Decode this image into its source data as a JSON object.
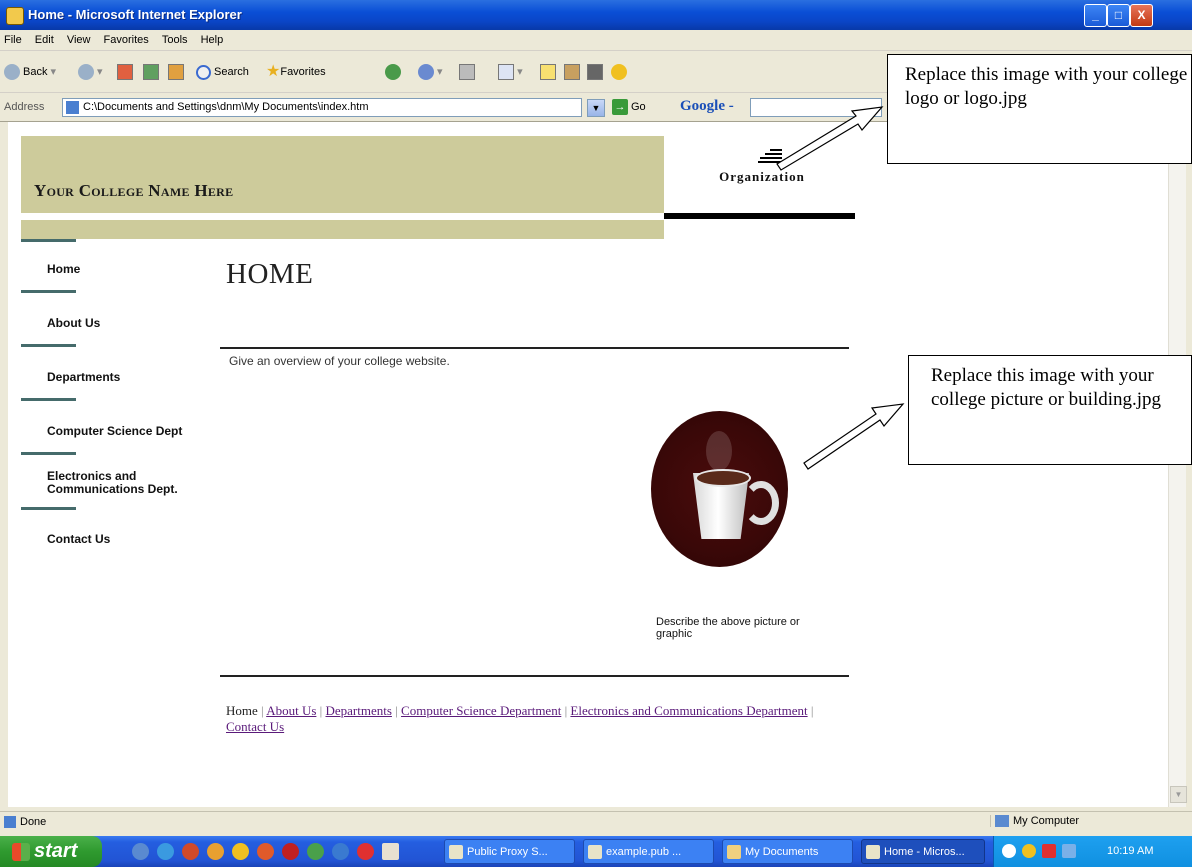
{
  "window": {
    "title": "Home - Microsoft Internet Explorer",
    "buttons": [
      "_",
      "□",
      "X"
    ]
  },
  "menubar": {
    "items": [
      "File",
      "Edit",
      "View",
      "Favorites",
      "Tools",
      "Help"
    ]
  },
  "toolbar": {
    "back_label": "Back",
    "search_label": "Search",
    "favorites_label": "Favorites"
  },
  "addressbar": {
    "label": "Address",
    "url": "C:\\Documents and Settings\\dnm\\My Documents\\index.htm",
    "go_label": "Go",
    "google_label": "Google -"
  },
  "page": {
    "college_name": "Your College Name Here",
    "logo_text": "Organization",
    "nav": [
      "Home",
      "About Us",
      "Departments",
      "Computer Science Dept",
      "Electronics and Communications Dept.",
      "Contact Us"
    ],
    "title": "HOME",
    "overview": "Give an overview of your college website.",
    "caption": "Describe the above picture or graphic",
    "footer": {
      "home": "Home",
      "links": [
        "About Us",
        "Departments",
        "Computer Science Department",
        "Electronics and Communications Department",
        "Contact Us"
      ],
      "separator": "|"
    }
  },
  "callouts": {
    "logo": "Replace this image with your college logo or logo.jpg",
    "picture": "Replace this image with your college picture or building.jpg"
  },
  "statusbar": {
    "status": "Done",
    "zone": "My Computer"
  },
  "taskbar": {
    "start_label": "start",
    "tasks": [
      "Public Proxy S...",
      "example.pub ...",
      "My Documents",
      "Home - Micros..."
    ],
    "clock": "10:19 AM"
  },
  "colors": {
    "banner": "#cdcb9b",
    "nav_separator": "#456b6b",
    "link": "#5a1a7a",
    "titlebar": "#0a4fd6"
  }
}
